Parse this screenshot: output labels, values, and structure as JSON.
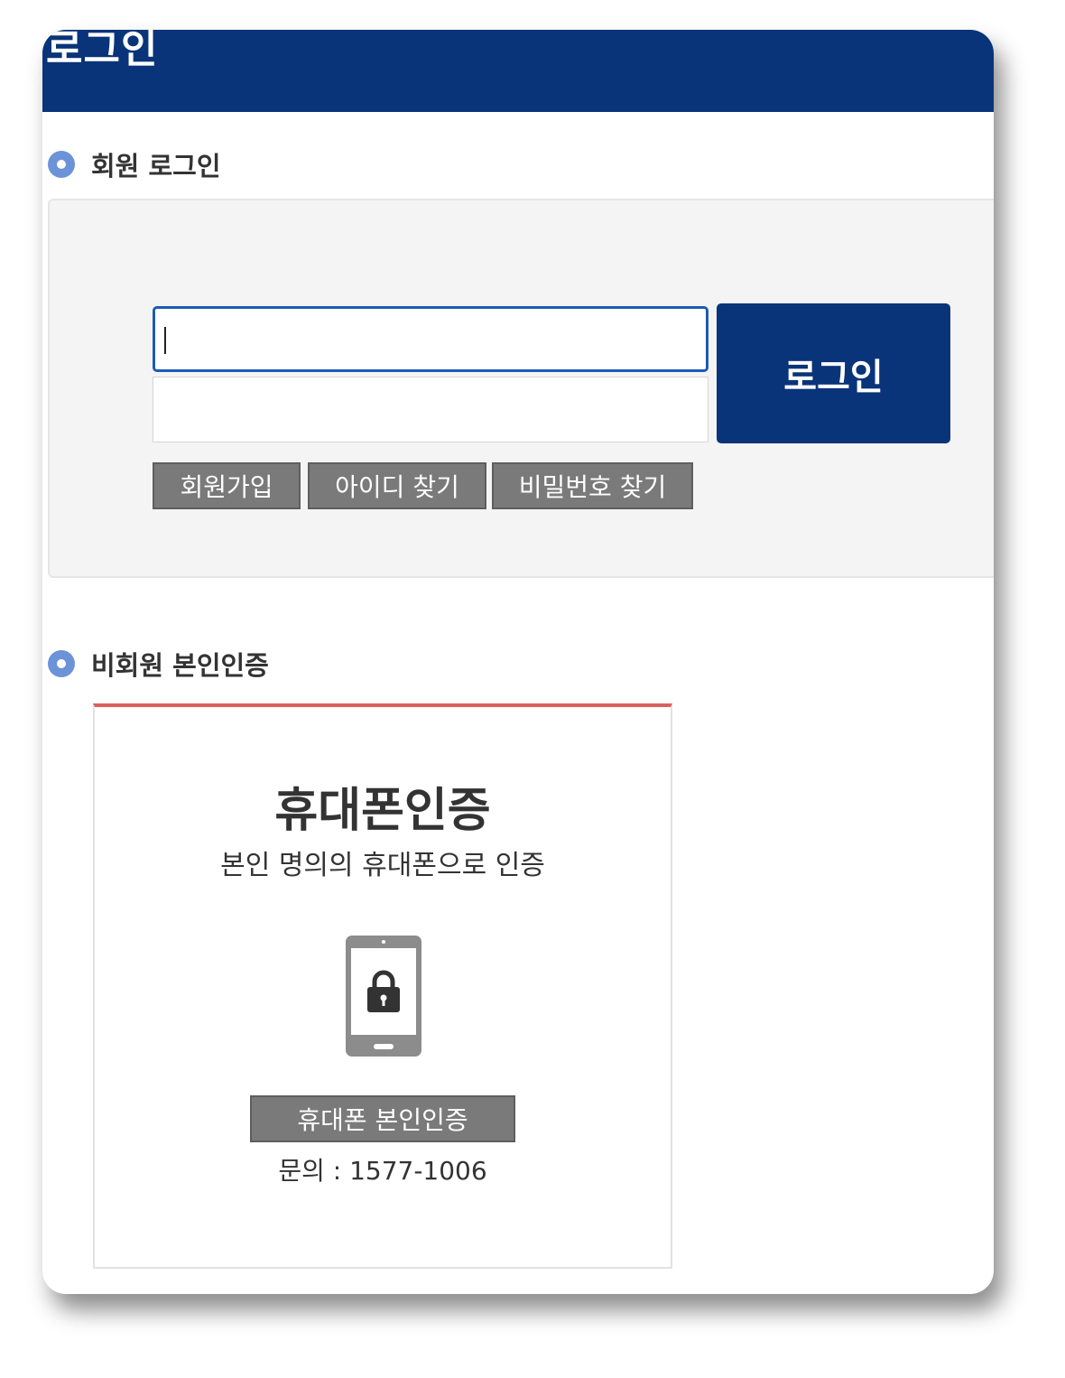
{
  "window": {
    "title": "로그인"
  },
  "member_login": {
    "heading": "회원 로그인",
    "id_value": "",
    "password_value": "",
    "login_button": "로그인",
    "links": {
      "join": "회원가입",
      "find_id": "아이디 찾기",
      "find_password": "비밀번호 찾기"
    }
  },
  "guest_verification": {
    "heading": "비회원 본인인증",
    "card_title": "휴대폰인증",
    "card_description": "본인 명의의 휴대폰으로 인증",
    "icon": "phone-lock-icon",
    "verify_button": "휴대폰 본인인증",
    "contact": "문의 : 1577-1006"
  },
  "colors": {
    "header_bg": "#0a3479",
    "login_button_bg": "#0a3479",
    "bullet": "#6c93d8",
    "gray_button": "#7a7a7a",
    "card_top_border": "#d9605e"
  }
}
